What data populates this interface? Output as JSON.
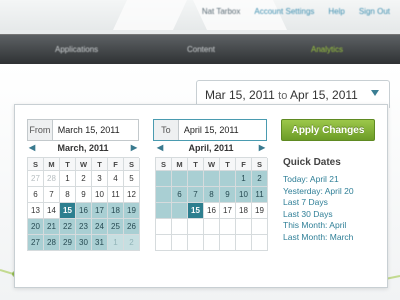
{
  "userbar": {
    "name": "Nat Tarbox",
    "links": [
      "Account Settings",
      "Help",
      "Sign Out"
    ]
  },
  "nav": {
    "items": [
      "Applications",
      "Content",
      "Analytics"
    ],
    "active": "Analytics"
  },
  "range": {
    "start": "Mar 15, 2011",
    "connector": "to",
    "end": "Apr 15, 2011"
  },
  "from_field": {
    "label": "From",
    "value": "March 15, 2011"
  },
  "to_field": {
    "label": "To",
    "value": "April 15, 2011"
  },
  "apply_label": "Apply Changes",
  "prev_arrow": "◀",
  "next_arrow": "▶",
  "weekdays": [
    "S",
    "M",
    "T",
    "W",
    "T",
    "F",
    "S"
  ],
  "calendars": [
    {
      "title": "March, 2011",
      "days": [
        {
          "d": "27",
          "m": 1
        },
        {
          "d": "28",
          "m": 1
        },
        {
          "d": "1"
        },
        {
          "d": "2"
        },
        {
          "d": "3"
        },
        {
          "d": "4"
        },
        {
          "d": "5"
        },
        {
          "d": "6"
        },
        {
          "d": "7"
        },
        {
          "d": "8"
        },
        {
          "d": "9"
        },
        {
          "d": "10"
        },
        {
          "d": "11"
        },
        {
          "d": "12"
        },
        {
          "d": "13"
        },
        {
          "d": "14"
        },
        {
          "d": "15",
          "s": 1
        },
        {
          "d": "16",
          "r": 1
        },
        {
          "d": "17",
          "r": 1
        },
        {
          "d": "18",
          "r": 1
        },
        {
          "d": "19",
          "r": 1
        },
        {
          "d": "20",
          "r": 1
        },
        {
          "d": "21",
          "r": 1
        },
        {
          "d": "22",
          "r": 1
        },
        {
          "d": "23",
          "r": 1
        },
        {
          "d": "24",
          "r": 1
        },
        {
          "d": "25",
          "r": 1
        },
        {
          "d": "26",
          "r": 1
        },
        {
          "d": "27",
          "r": 1
        },
        {
          "d": "28",
          "r": 1
        },
        {
          "d": "29",
          "r": 1
        },
        {
          "d": "30",
          "r": 1
        },
        {
          "d": "31",
          "r": 1
        },
        {
          "d": "1",
          "r": 1,
          "m": 1
        },
        {
          "d": "2",
          "r": 1,
          "m": 1
        }
      ]
    },
    {
      "title": "April, 2011",
      "days": [
        {
          "d": "",
          "r": 1
        },
        {
          "d": "",
          "r": 1
        },
        {
          "d": "",
          "r": 1
        },
        {
          "d": "",
          "r": 1
        },
        {
          "d": "",
          "r": 1
        },
        {
          "d": "1",
          "r": 1
        },
        {
          "d": "2",
          "r": 1
        },
        {
          "d": "",
          "r": 1
        },
        {
          "d": "6",
          "r": 1
        },
        {
          "d": "7",
          "r": 1
        },
        {
          "d": "8",
          "r": 1
        },
        {
          "d": "9",
          "r": 1
        },
        {
          "d": "10",
          "r": 1
        },
        {
          "d": "11",
          "r": 1
        },
        {
          "d": "",
          "r": 1
        },
        {
          "d": "",
          "r": 1
        },
        {
          "d": "15",
          "s": 1
        },
        {
          "d": "16"
        },
        {
          "d": "17"
        },
        {
          "d": "18"
        },
        {
          "d": "19"
        },
        {
          "d": ""
        },
        {
          "d": ""
        },
        {
          "d": ""
        },
        {
          "d": ""
        },
        {
          "d": ""
        },
        {
          "d": ""
        },
        {
          "d": ""
        },
        {
          "d": ""
        },
        {
          "d": ""
        },
        {
          "d": ""
        },
        {
          "d": ""
        },
        {
          "d": ""
        },
        {
          "d": ""
        },
        {
          "d": ""
        }
      ]
    }
  ],
  "quick_dates": {
    "title": "Quick Dates",
    "items": [
      "Today: April 21",
      "Yesterday: April 20",
      "Last 7 Days",
      "Last 30 Days",
      "This Month: April",
      "Last Month: March"
    ]
  },
  "colors": {
    "accent": "#2d7f8f",
    "range": "#a9cfd3",
    "apply": "#7fae33",
    "link": "#2f7f97"
  }
}
